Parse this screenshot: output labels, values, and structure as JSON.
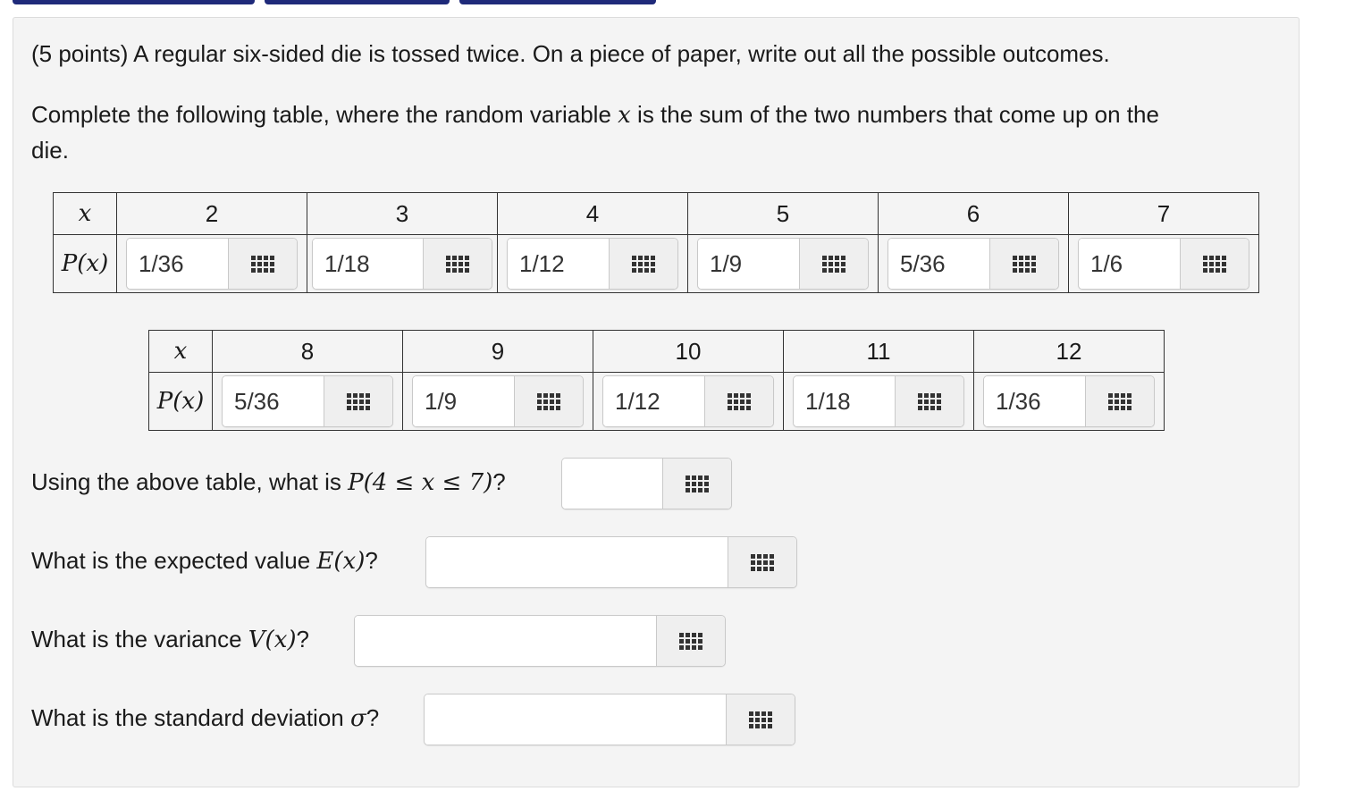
{
  "question": {
    "intro": "(5 points) A regular six-sided die is tossed twice. On a piece of paper, write out all the possible outcomes.",
    "instruction_line1_a": "Complete the following table, where the random variable ",
    "instruction_var": "x",
    "instruction_line1_b": " is the sum of the two numbers that come up on the",
    "instruction_line2": "die."
  },
  "table1": {
    "x_label": "x",
    "p_label": "P(x)",
    "columns": [
      {
        "x": "2",
        "value": "1/36"
      },
      {
        "x": "3",
        "value": "1/18"
      },
      {
        "x": "4",
        "value": "1/12"
      },
      {
        "x": "5",
        "value": "1/9"
      },
      {
        "x": "6",
        "value": "5/36"
      },
      {
        "x": "7",
        "value": "1/6"
      }
    ]
  },
  "table2": {
    "x_label": "x",
    "p_label": "P(x)",
    "columns": [
      {
        "x": "8",
        "value": "5/36"
      },
      {
        "x": "9",
        "value": "1/9"
      },
      {
        "x": "10",
        "value": "1/12"
      },
      {
        "x": "11",
        "value": "1/18"
      },
      {
        "x": "12",
        "value": "1/36"
      }
    ]
  },
  "q_prob": {
    "text": "Using the above table, what is ",
    "math": "P(4 ≤ x ≤ 7)",
    "suffix": "?",
    "value": ""
  },
  "q_expected": {
    "text": "What is the expected value ",
    "math": "E(x)",
    "suffix": "?",
    "value": ""
  },
  "q_variance": {
    "text": "What is the variance ",
    "math": "V(x)",
    "suffix": "?",
    "value": ""
  },
  "q_sd": {
    "text": "What is the standard deviation ",
    "math": "σ",
    "suffix": "?",
    "value": ""
  },
  "icons": {
    "answer_tools": "grid-icon"
  },
  "colors": {
    "tab": "#1f2a7a",
    "panel": "#f4f4f4",
    "border": "#333333"
  }
}
